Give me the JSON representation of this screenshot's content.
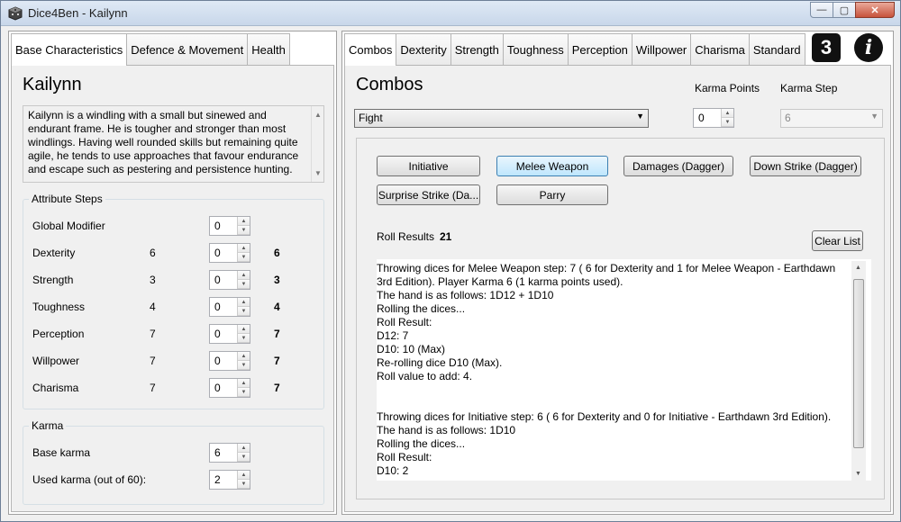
{
  "window": {
    "title": "Dice4Ben - Kailynn",
    "buttons": {
      "minimize": "—",
      "maximize": "▢",
      "close": "✕"
    }
  },
  "left": {
    "tabs": [
      "Base Characteristics",
      "Defence & Movement",
      "Health"
    ],
    "character_name": "Kailynn",
    "description": "Kailynn is a windling with a small but sinewed and endurant frame. He is tougher and stronger than most windlings. Having well rounded skills but remaining quite agile, he tends to use approaches that favour endurance and escape such as pestering and persistence hunting.",
    "attribute_group_label": "Attribute Steps",
    "global_modifier": {
      "label": "Global Modifier",
      "value": "0"
    },
    "attributes": [
      {
        "name": "Dexterity",
        "base": "6",
        "mod": "0",
        "final": "6"
      },
      {
        "name": "Strength",
        "base": "3",
        "mod": "0",
        "final": "3"
      },
      {
        "name": "Toughness",
        "base": "4",
        "mod": "0",
        "final": "4"
      },
      {
        "name": "Perception",
        "base": "7",
        "mod": "0",
        "final": "7"
      },
      {
        "name": "Willpower",
        "base": "7",
        "mod": "0",
        "final": "7"
      },
      {
        "name": "Charisma",
        "base": "7",
        "mod": "0",
        "final": "7"
      }
    ],
    "karma_group_label": "Karma",
    "base_karma": {
      "label": "Base karma",
      "value": "6"
    },
    "used_karma": {
      "label": "Used karma  (out of 60):",
      "value": "2"
    }
  },
  "right": {
    "tabs": [
      "Combos",
      "Dexterity",
      "Strength",
      "Toughness",
      "Perception",
      "Willpower",
      "Charisma",
      "Standard"
    ],
    "badge_number": "3",
    "info_label": "i",
    "section_title": "Combos",
    "combo_select": "Fight",
    "karma_points": {
      "label": "Karma Points",
      "value": "0"
    },
    "karma_step": {
      "label": "Karma Step",
      "value": "6"
    },
    "buttons": [
      "Initiative",
      "Melee Weapon",
      "Damages (Dagger)",
      "Down Strike (Dagger)",
      "Surprise Strike (Da...",
      "Parry"
    ],
    "roll_results_label": "Roll Results",
    "roll_results_value": "21",
    "clear_list": "Clear List",
    "log": "Throwing dices for Melee Weapon step: 7 ( 6 for Dexterity and 1 for Melee Weapon - Earthdawn 3rd Edition). Player Karma 6 (1 karma points used).\nThe hand is as follows: 1D12 + 1D10\nRolling the dices...\nRoll Result:\nD12: 7\nD10: 10   (Max)\nRe-rolling dice D10 (Max).\nRoll value to add: 4.\n\n\nThrowing dices for Initiative step: 6 ( 6 for Dexterity and 0 for Initiative - Earthdawn 3rd Edition).\nThe hand is as follows: 1D10\nRolling the dices...\nRoll Result:\nD10: 2"
  }
}
